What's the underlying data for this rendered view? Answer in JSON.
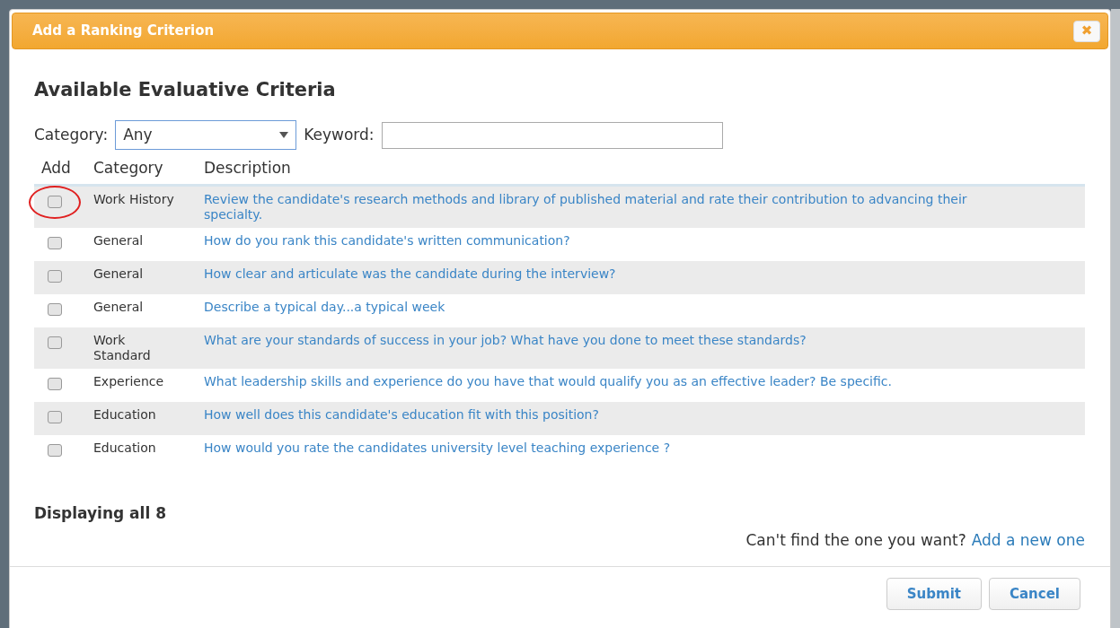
{
  "dialog": {
    "title": "Add a Ranking Criterion",
    "close_icon": "✖"
  },
  "heading": "Available Evaluative Criteria",
  "filters": {
    "category_label": "Category:",
    "category_value": "Any",
    "keyword_label": "Keyword:"
  },
  "table": {
    "columns": [
      "Add",
      "Category",
      "Description"
    ],
    "rows": [
      {
        "checked": false,
        "annotated": true,
        "category": "Work History",
        "description": "Review the candidate's research methods and library of published material and rate their contribution to advancing their specialty."
      },
      {
        "checked": false,
        "annotated": false,
        "category": "General",
        "description": "How do you rank this candidate's written communication?"
      },
      {
        "checked": false,
        "annotated": false,
        "category": "General",
        "description": "How clear and articulate was the candidate during the interview?"
      },
      {
        "checked": false,
        "annotated": false,
        "category": "General",
        "description": "Describe a typical day...a typical week"
      },
      {
        "checked": false,
        "annotated": false,
        "category": "Work Standard",
        "description": "What are your standards of success in your job? What have you done to meet these standards?"
      },
      {
        "checked": false,
        "annotated": false,
        "category": "Experience",
        "description": "What leadership skills and experience do you have that would qualify you as an effective leader? Be specific."
      },
      {
        "checked": false,
        "annotated": false,
        "category": "Education",
        "description": "How well does this candidate's education fit with this position?"
      },
      {
        "checked": false,
        "annotated": false,
        "category": "Education",
        "description": "How would you rate the candidates university level teaching experience ?"
      }
    ]
  },
  "count_text": "Displaying all 8",
  "help": {
    "question": "Can't find the one you want?",
    "link": "Add a new one"
  },
  "buttons": [
    "Submit",
    "Cancel"
  ]
}
